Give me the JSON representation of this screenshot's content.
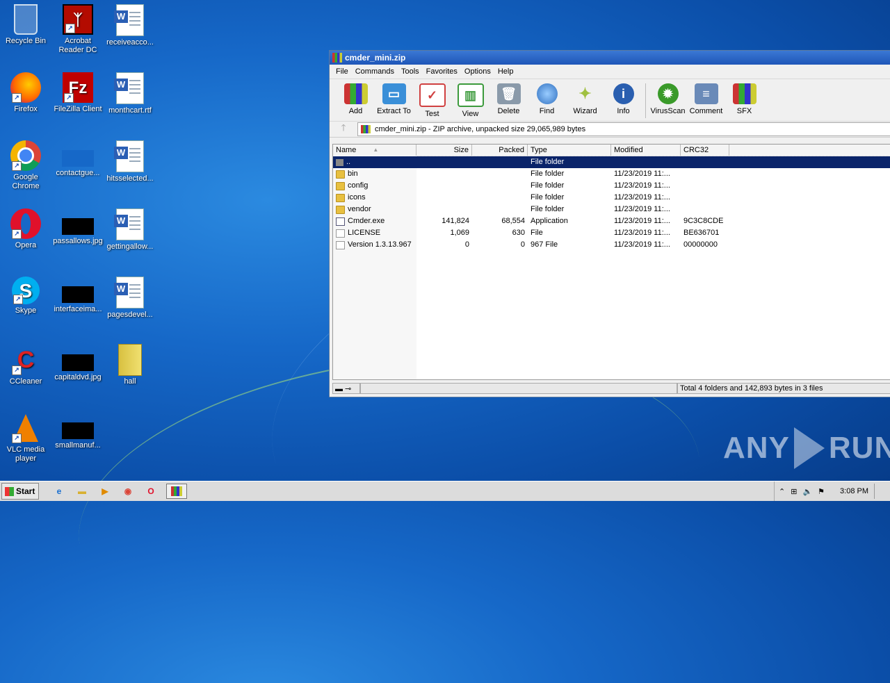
{
  "desktop": {
    "icons": [
      {
        "label": "Recycle Bin",
        "icon": "recycle-bin-icon"
      },
      {
        "label": "Acrobat Reader DC",
        "icon": "acrobat-icon"
      },
      {
        "label": "receiveacco...",
        "icon": "word-doc-icon"
      },
      {
        "label": "Firefox",
        "icon": "firefox-icon"
      },
      {
        "label": "FileZilla Client",
        "icon": "filezilla-icon"
      },
      {
        "label": "monthcart.rtf",
        "icon": "word-doc-icon"
      },
      {
        "label": "Google Chrome",
        "icon": "chrome-icon"
      },
      {
        "label": "contactgue...",
        "icon": "image-icon"
      },
      {
        "label": "hitsselected...",
        "icon": "word-doc-icon"
      },
      {
        "label": "Opera",
        "icon": "opera-icon"
      },
      {
        "label": "passallows.jpg",
        "icon": "image-icon"
      },
      {
        "label": "gettingallow...",
        "icon": "word-doc-icon"
      },
      {
        "label": "Skype",
        "icon": "skype-icon"
      },
      {
        "label": "interfaceima...",
        "icon": "image-icon"
      },
      {
        "label": "pagesdevel...",
        "icon": "word-doc-icon"
      },
      {
        "label": "CCleaner",
        "icon": "ccleaner-icon"
      },
      {
        "label": "capitaldvd.jpg",
        "icon": "image-icon"
      },
      {
        "label": "hall",
        "icon": "folder-icon"
      },
      {
        "label": "VLC media player",
        "icon": "vlc-icon"
      },
      {
        "label": "smallmanuf...",
        "icon": "image-icon"
      }
    ]
  },
  "window": {
    "title": "cmder_mini.zip",
    "menu": [
      "File",
      "Commands",
      "Tools",
      "Favorites",
      "Options",
      "Help"
    ],
    "toolbar": [
      {
        "label": "Add",
        "icon": "add-icon",
        "color": "#c0392b"
      },
      {
        "label": "Extract To",
        "icon": "extract-icon",
        "color": "#3a8fd8"
      },
      {
        "label": "Test",
        "icon": "test-icon",
        "color": "#d04040"
      },
      {
        "label": "View",
        "icon": "view-icon",
        "color": "#3c9a3c"
      },
      {
        "label": "Delete",
        "icon": "delete-icon",
        "color": "#8a9aaa"
      },
      {
        "label": "Find",
        "icon": "find-icon",
        "color": "#3070c0"
      },
      {
        "label": "Wizard",
        "icon": "wizard-icon",
        "color": "#a0c040"
      },
      {
        "label": "Info",
        "icon": "info-icon",
        "color": "#2a5fb0"
      },
      {
        "label": "VirusScan",
        "icon": "virusscan-icon",
        "color": "#3a9a2a"
      },
      {
        "label": "Comment",
        "icon": "comment-icon",
        "color": "#6a8ab8"
      },
      {
        "label": "SFX",
        "icon": "sfx-icon",
        "color": "#c07030"
      }
    ],
    "address": "cmder_mini.zip - ZIP archive, unpacked size 29,065,989 bytes",
    "columns": [
      "Name",
      "Size",
      "Packed",
      "Type",
      "Modified",
      "CRC32"
    ],
    "rows": [
      {
        "name": "..",
        "size": "",
        "packed": "",
        "type": "File folder",
        "modified": "",
        "crc": "",
        "kind": "up"
      },
      {
        "name": "bin",
        "size": "",
        "packed": "",
        "type": "File folder",
        "modified": "11/23/2019 11:...",
        "crc": "",
        "kind": "folder"
      },
      {
        "name": "config",
        "size": "",
        "packed": "",
        "type": "File folder",
        "modified": "11/23/2019 11:...",
        "crc": "",
        "kind": "folder"
      },
      {
        "name": "icons",
        "size": "",
        "packed": "",
        "type": "File folder",
        "modified": "11/23/2019 11:...",
        "crc": "",
        "kind": "folder"
      },
      {
        "name": "vendor",
        "size": "",
        "packed": "",
        "type": "File folder",
        "modified": "11/23/2019 11:...",
        "crc": "",
        "kind": "folder"
      },
      {
        "name": "Cmder.exe",
        "size": "141,824",
        "packed": "68,554",
        "type": "Application",
        "modified": "11/23/2019 11:...",
        "crc": "9C3C8CDE",
        "kind": "exe"
      },
      {
        "name": "LICENSE",
        "size": "1,069",
        "packed": "630",
        "type": "File",
        "modified": "11/23/2019 11:...",
        "crc": "BE636701",
        "kind": "doc"
      },
      {
        "name": "Version 1.3.13.967",
        "size": "0",
        "packed": "0",
        "type": "967 File",
        "modified": "11/23/2019 11:...",
        "crc": "00000000",
        "kind": "doc"
      }
    ],
    "status": "Total 4 folders and 142,893 bytes in 3 files"
  },
  "taskbar": {
    "start_label": "Start",
    "clock": "3:08 PM"
  },
  "watermark": {
    "left": "ANY",
    "right": "RUN"
  }
}
